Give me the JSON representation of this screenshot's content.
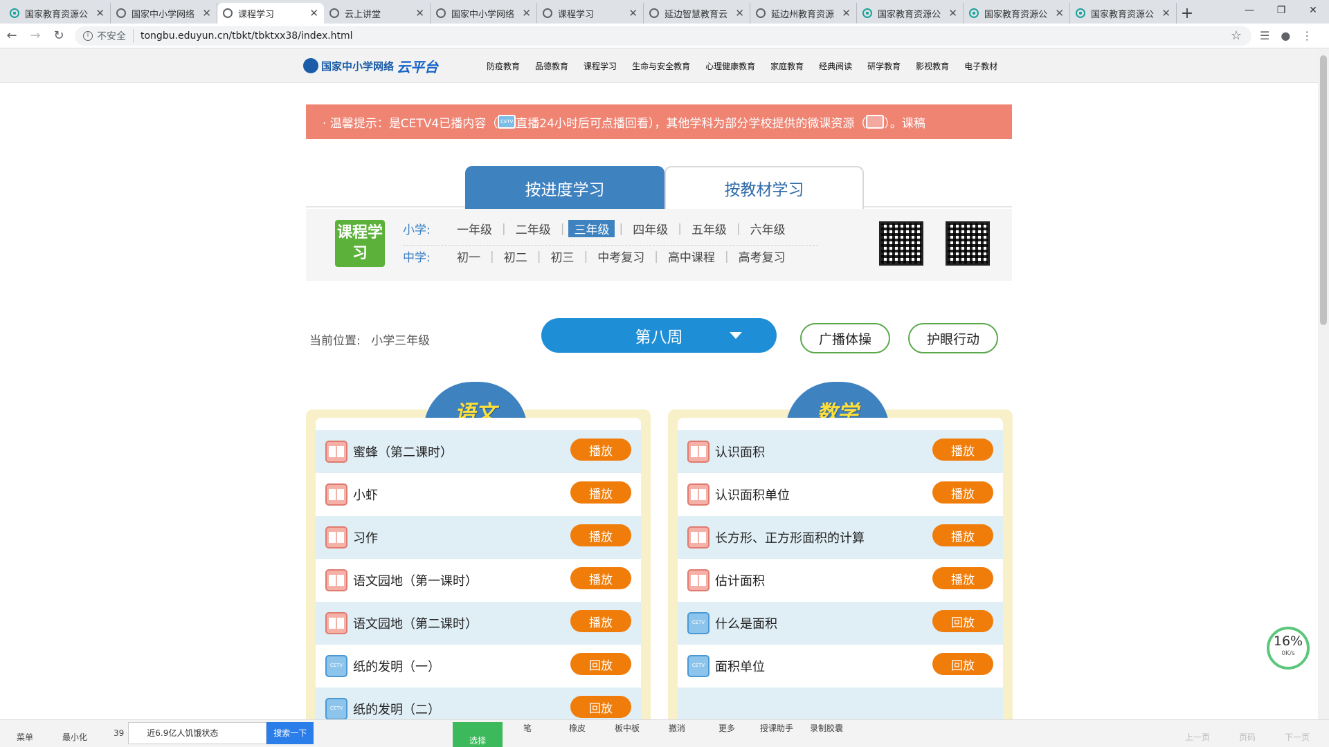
{
  "browser": {
    "tabs": [
      {
        "label": "国家教育资源公",
        "icon": "teal-leaf-icon"
      },
      {
        "label": "国家中小学网络",
        "icon": "globe-icon"
      },
      {
        "label": "课程学习",
        "icon": "globe-icon",
        "active": true
      },
      {
        "label": "云上讲堂",
        "icon": "globe-icon"
      },
      {
        "label": "国家中小学网络",
        "icon": "globe-icon"
      },
      {
        "label": "课程学习",
        "icon": "globe-icon"
      },
      {
        "label": "延边智慧教育云",
        "icon": "globe-icon"
      },
      {
        "label": "延边州教育资源",
        "icon": "person-icon"
      },
      {
        "label": "国家教育资源公",
        "icon": "teal-leaf-icon"
      },
      {
        "label": "国家教育资源公",
        "icon": "teal-leaf-icon"
      },
      {
        "label": "国家教育资源公",
        "icon": "teal-leaf-icon"
      }
    ],
    "security": "不安全",
    "url": "tongbu.eduyun.cn/tbkt/tbktxx38/index.html"
  },
  "site": {
    "logo_text": "国家中小学网络",
    "logo_cloud": "云平台",
    "nav": [
      "防疫教育",
      "品德教育",
      "课程学习",
      "生命与安全教育",
      "心理健康教育",
      "家庭教育",
      "经典阅读",
      "研学教育",
      "影视教育",
      "电子教材"
    ]
  },
  "notice": {
    "prefix": "· 温馨提示：",
    "part1": "是CETV4已播内容（",
    "part2": "直播24小时后可点播回看），其他学科为部分学校提供的微课资源（",
    "part3": "）。课稿"
  },
  "mode_tabs": {
    "progress": "按进度学习",
    "textbook": "按教材学习"
  },
  "grades": {
    "badge": "课程学习",
    "primary_label": "小学:",
    "primary": [
      "一年级",
      "二年级",
      "三年级",
      "四年级",
      "五年级",
      "六年级"
    ],
    "primary_selected": "三年级",
    "secondary_label": "中学:",
    "secondary": [
      "初一",
      "初二",
      "初三",
      "中考复习",
      "高中课程",
      "高考复习"
    ]
  },
  "location": {
    "label": "当前位置:",
    "value": "小学三年级"
  },
  "week": "第八周",
  "buttons": {
    "broadcast": "广播体操",
    "eyecare": "护眼行动"
  },
  "subjects": {
    "chinese": {
      "title": "语文",
      "items": [
        {
          "label": "蜜蜂（第二课时）",
          "type": "book",
          "action": "播放"
        },
        {
          "label": "小虾",
          "type": "book",
          "action": "播放"
        },
        {
          "label": "习作",
          "type": "book",
          "action": "播放"
        },
        {
          "label": "语文园地（第一课时）",
          "type": "book",
          "action": "播放"
        },
        {
          "label": "语文园地（第二课时）",
          "type": "book",
          "action": "播放"
        },
        {
          "label": "纸的发明（一）",
          "type": "tv",
          "action": "回放"
        },
        {
          "label": "纸的发明（二）",
          "type": "tv",
          "action": "回放"
        }
      ]
    },
    "math": {
      "title": "数学",
      "items": [
        {
          "label": "认识面积",
          "type": "book",
          "action": "播放"
        },
        {
          "label": "认识面积单位",
          "type": "book",
          "action": "播放"
        },
        {
          "label": "长方形、正方形面积的计算",
          "type": "book",
          "action": "播放"
        },
        {
          "label": "估计面积",
          "type": "book",
          "action": "播放"
        },
        {
          "label": "什么是面积",
          "type": "tv",
          "action": "回放"
        },
        {
          "label": "面积单位",
          "type": "tv",
          "action": "回放"
        }
      ]
    }
  },
  "cetv_icon_text": "CETV",
  "speed_widget": {
    "percent": "16%",
    "rate": "0K/s"
  },
  "taskbar": {
    "left": [
      "菜单",
      "最小化"
    ],
    "count": "39",
    "search_hint": "近6.9亿人饥饿状态",
    "search_button": "搜索一下",
    "center": [
      "选择",
      "笔",
      "橡皮",
      "板中板",
      "撤消",
      "更多",
      "授课助手",
      "录制胶囊"
    ],
    "right": [
      "上一页",
      "页码",
      "下一页"
    ]
  }
}
